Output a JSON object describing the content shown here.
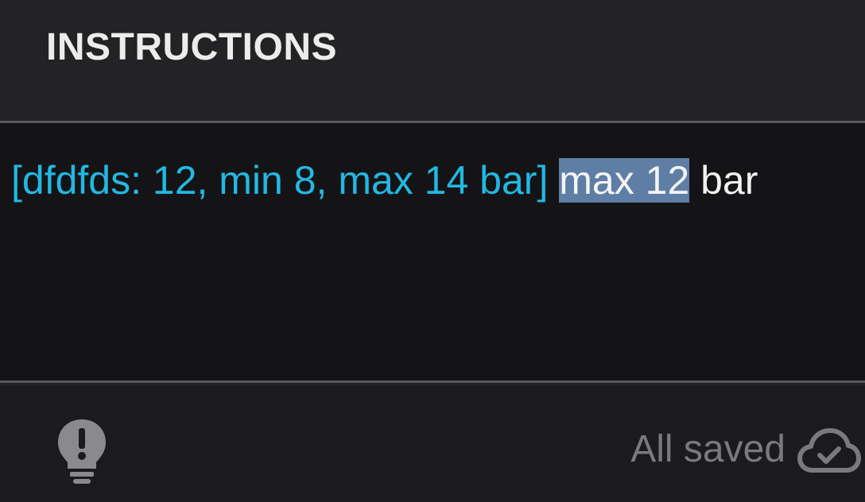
{
  "header": {
    "title": "INSTRUCTIONS"
  },
  "editor": {
    "tag_text": "[dfdfds: 12, min 8, max 14 bar]",
    "separator": " ",
    "selected_text": "max 12",
    "trailing_text": " bar"
  },
  "footer": {
    "status_text": "All saved",
    "hint_icon": "lightbulb-exclamation-icon",
    "status_icon": "cloud-check-icon"
  },
  "colors": {
    "tag": "#22b8e3",
    "selection": "#5e7ea5",
    "status": "#7a7a7d"
  }
}
